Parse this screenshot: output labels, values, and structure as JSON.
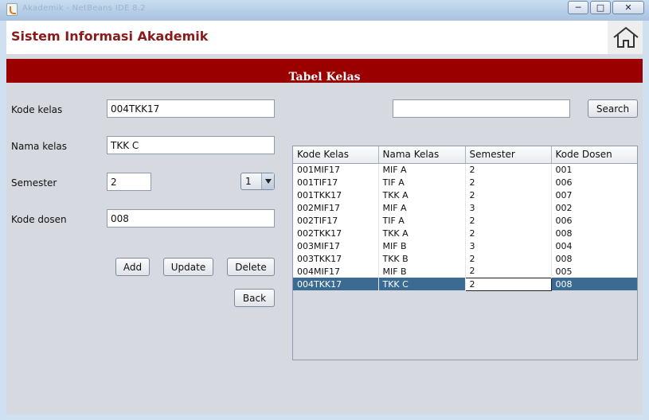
{
  "window": {
    "title": "Akademik - NetBeans IDE 8.2",
    "controls": [
      "minimize",
      "maximize",
      "close"
    ]
  },
  "header": {
    "app_title": "Sistem Informasi Akademik",
    "home_icon": "home-icon"
  },
  "banner": {
    "title": "Tabel Kelas"
  },
  "form": {
    "kode_kelas": {
      "label": "Kode kelas",
      "value": "004TKK17"
    },
    "nama_kelas": {
      "label": "Nama kelas",
      "value": "TKK C"
    },
    "semester": {
      "label": "Semester",
      "value": "2",
      "combo_value": "1"
    },
    "kode_dosen": {
      "label": "Kode dosen",
      "value": "008"
    }
  },
  "buttons": {
    "add": "Add",
    "update": "Update",
    "delete": "Delete",
    "back": "Back"
  },
  "search": {
    "value": "",
    "button": "Search"
  },
  "table": {
    "columns": [
      "Kode Kelas",
      "Nama Kelas",
      "Semester",
      "Kode Dosen"
    ],
    "rows": [
      [
        "001MIF17",
        "MIF A",
        "2",
        "001"
      ],
      [
        "001TIF17",
        "TIF A",
        "2",
        "006"
      ],
      [
        "001TKK17",
        "TKK A",
        "2",
        "007"
      ],
      [
        "002MIF17",
        "MIF A",
        "3",
        "002"
      ],
      [
        "002TIF17",
        "TIF A",
        "2",
        "006"
      ],
      [
        "002TKK17",
        "TKK A",
        "2",
        "008"
      ],
      [
        "003MIF17",
        "MIF B",
        "3",
        "004"
      ],
      [
        "003TKK17",
        "TKK B",
        "2",
        "008"
      ],
      [
        "004MIF17",
        "MIF B",
        "2",
        "005"
      ],
      [
        "004TKK17",
        "TKK C",
        "2",
        "008"
      ]
    ],
    "selected_row": 9
  },
  "colors": {
    "accent": "#9b0000",
    "title_text": "#8b1a1a",
    "selection": "#3b6a93"
  }
}
